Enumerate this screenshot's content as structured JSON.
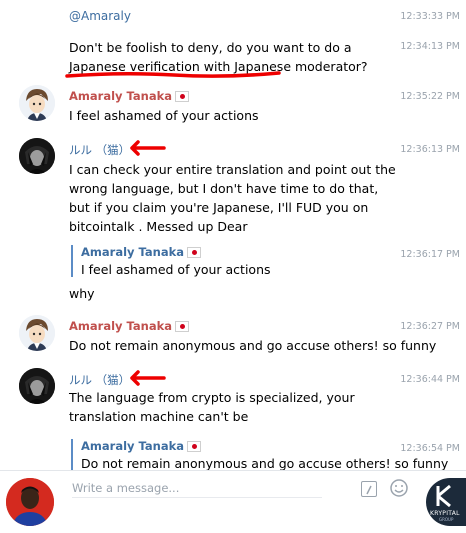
{
  "messages": {
    "top_username": "@Amaraly",
    "top_time": "12:33:33 PM",
    "m1_text": "Don't be foolish to deny, do you want to do a Japanese verification with Japanese moderator?",
    "m1_time": "12:34:13 PM",
    "m2_name": "Amaraly Tanaka",
    "m2_time": "12:35:22 PM",
    "m2_text": "I feel ashamed of your actions",
    "m3_name": "ルル （猫）",
    "m3_time": "12:36:13 PM",
    "m3_text": "I can check your entire translation and point out the wrong language, but I don't have time to do that, but if you claim you're Japanese, I'll FUD you on bitcointalk . Messed up Dear",
    "m4_reply_name": "Amaraly Tanaka",
    "m4_reply_text": "I feel ashamed of your actions",
    "m4_time": "12:36:17 PM",
    "m4_text": "why",
    "m5_name": "Amaraly Tanaka",
    "m5_time": "12:36:27 PM",
    "m5_text": "Do not remain anonymous and go accuse others!  so funny",
    "m6_name": "ルル （猫）",
    "m6_time": "12:36:44 PM",
    "m6_text": "The language from crypto is specialized, your translation machine can't be",
    "m7_reply_name": "Amaraly Tanaka",
    "m7_reply_text": "Do not remain anonymous and go accuse others!  so funny",
    "m7_time": "12:36:54 PM"
  },
  "composer": {
    "placeholder": "Write a message...",
    "command_icon": "slash-command-icon",
    "emoji_icon": "smiley-emoji-icon"
  },
  "brand": {
    "name": "KRYPITAL",
    "sub": "GROUP"
  },
  "colors": {
    "amaraly_name": "#c0504d",
    "lulu_name": "#3d6da0",
    "reply_bar": "#5b8cc6",
    "annotation_red": "#ee0000"
  }
}
